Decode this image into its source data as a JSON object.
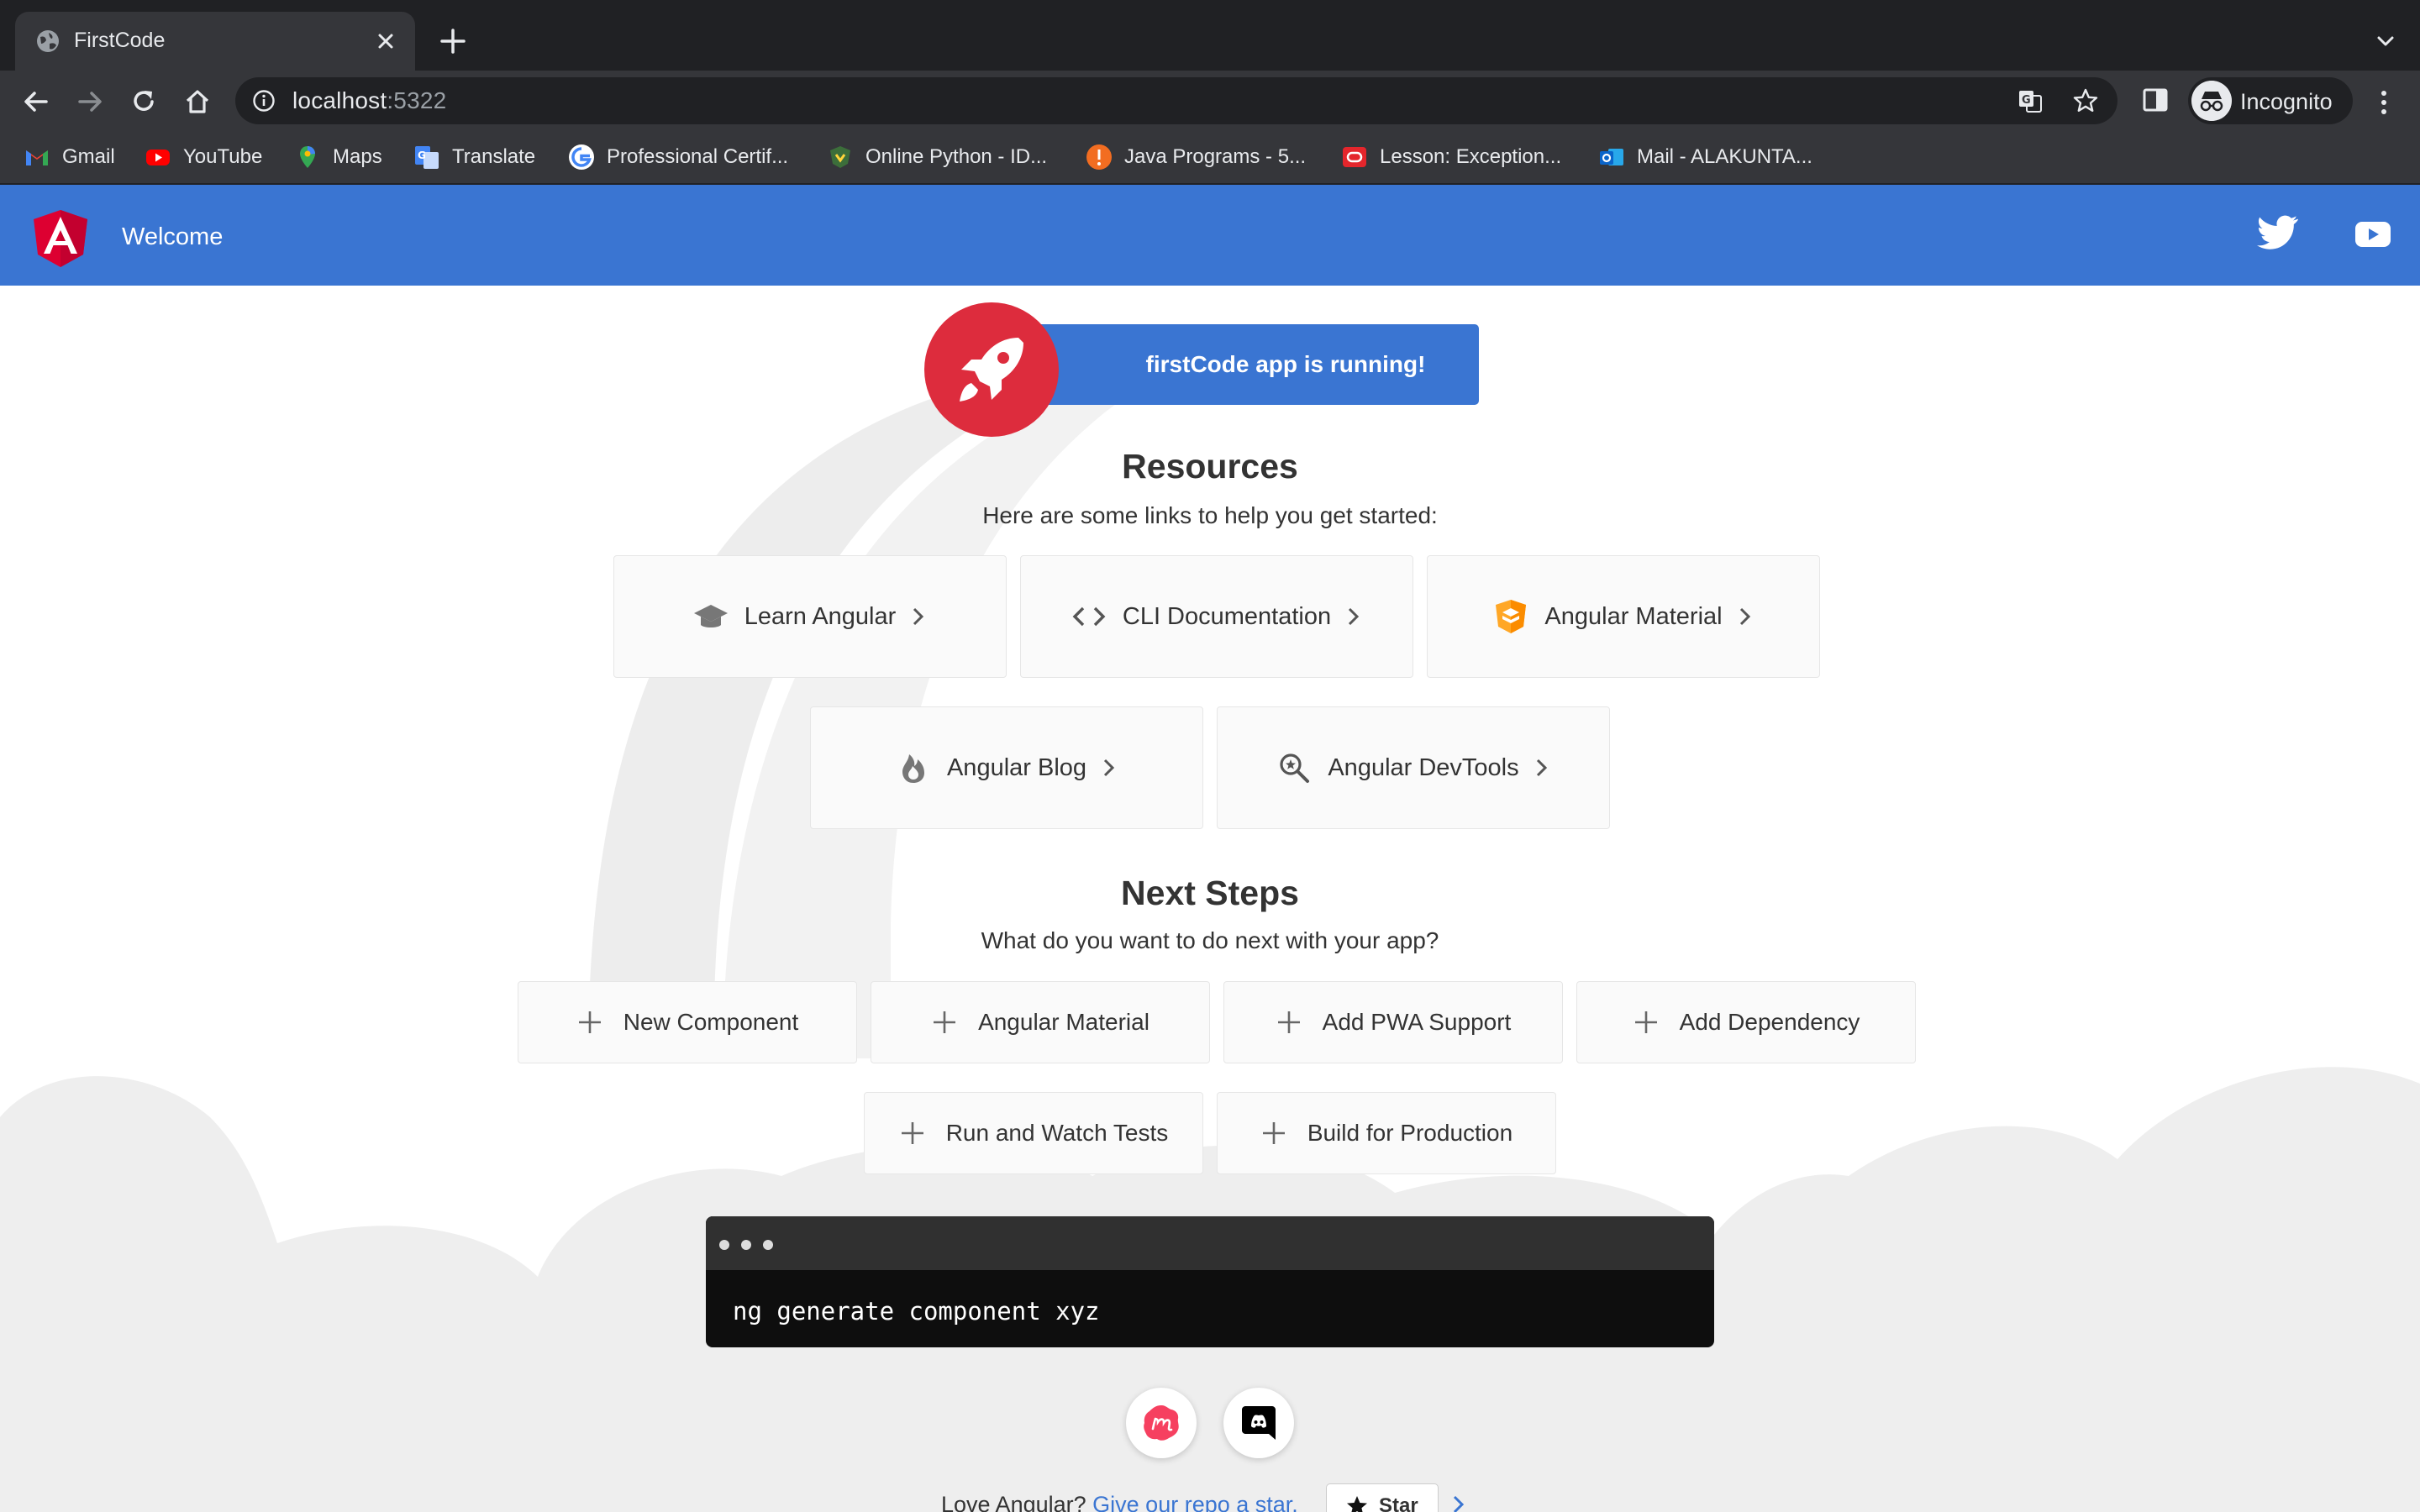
{
  "browser": {
    "tab_title": "FirstCode",
    "url_host": "localhost",
    "url_port": ":5322",
    "profile_label": "Incognito",
    "bookmarks": [
      {
        "label": "Gmail",
        "icon": "gmail-icon"
      },
      {
        "label": "YouTube",
        "icon": "youtube-icon"
      },
      {
        "label": "Maps",
        "icon": "maps-icon"
      },
      {
        "label": "Translate",
        "icon": "translate-icon"
      },
      {
        "label": "Professional Certif...",
        "icon": "google-icon"
      },
      {
        "label": "Online Python - ID...",
        "icon": "python-ide-icon"
      },
      {
        "label": "Java Programs - 5...",
        "icon": "java-icon"
      },
      {
        "label": "Lesson: Exception...",
        "icon": "oracle-icon"
      },
      {
        "label": "Mail - ALAKUNTA...",
        "icon": "outlook-icon"
      }
    ]
  },
  "app": {
    "toolbar_title": "Welcome",
    "running_banner": "firstCode app is running!",
    "resources_title": "Resources",
    "resources_subtitle": "Here are some links to help you get started:",
    "resources": [
      {
        "label": "Learn Angular",
        "icon": "graduation-cap-icon"
      },
      {
        "label": "CLI Documentation",
        "icon": "code-brackets-icon"
      },
      {
        "label": "Angular Material",
        "icon": "angular-material-icon"
      },
      {
        "label": "Angular Blog",
        "icon": "flame-icon"
      },
      {
        "label": "Angular DevTools",
        "icon": "devtools-search-icon"
      }
    ],
    "next_steps_title": "Next Steps",
    "next_steps_subtitle": "What do you want to do next with your app?",
    "next_steps": [
      "New Component",
      "Angular Material",
      "Add PWA Support",
      "Add Dependency",
      "Run and Watch Tests",
      "Build for Production"
    ],
    "terminal_command": "ng generate component xyz",
    "love_text": "Love Angular?",
    "love_link": "Give our repo a star.",
    "star_label": "Star"
  },
  "colors": {
    "angular_blue": "#3a75d2",
    "angular_red": "#dd2c3d",
    "chrome_dark": "#202124",
    "chrome_toolbar": "#35363a"
  }
}
